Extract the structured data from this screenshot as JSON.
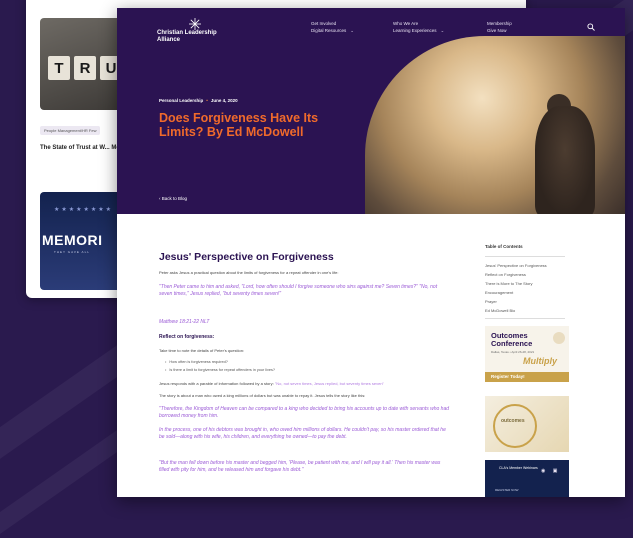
{
  "colors": {
    "background": "#2a1a4e",
    "hero_bg": "#2b1352",
    "title_accent": "#f06a2b",
    "quote_text": "#9b5bd6",
    "heading": "#2b1352",
    "gold": "#c9a24a"
  },
  "back_card": {
    "thumb1_tiles": [
      "T",
      "R",
      "U"
    ],
    "tag": "People Management/HR Few",
    "title": "The State of Trust at W... McKenna",
    "thumb2_text": "MEMORI",
    "thumb2_sub": "THEY GAVE ALL"
  },
  "header": {
    "logo_text": "Christian Leadership Alliance",
    "logo_icon": "star-burst-icon",
    "nav": [
      {
        "line1": "Get Involved",
        "line2": "Digital Resources"
      },
      {
        "line1": "Who We Are",
        "line2": "Learning Experiences"
      },
      {
        "line1": "Membership",
        "line2": "Give Now"
      }
    ],
    "search_icon": "search-icon"
  },
  "hero": {
    "category": "Personal Leadership",
    "date": "June 4, 2020",
    "title": "Does Forgiveness Have Its Limits? By Ed McDowell",
    "back_link": "‹ Back to Blog"
  },
  "article": {
    "heading": "Jesus' Perspective on Forgiveness",
    "intro": "Peter asks Jesus a practical question about the limits of forgiveness for a repeat offender in one's life:",
    "quote1": "\"Then Peter came to him and asked, \"Lord, how often should I forgive someone who sins against me? Seven times?\" \"No, not seven times,\" Jesus replied, \"but seventy times seven!\"",
    "quote1_ref": "Matthew 18:21-22 NLT",
    "subheading": "Reflect on forgiveness:",
    "sub_intro": "Take time to note the details of Peter's question:",
    "bullets": [
      "How often is forgiveness required?",
      "Is there a limit to forgiveness for repeat offenders in your lives?"
    ],
    "response_text": "Jesus responds with a parable of information followed by a story:",
    "response_link": "\"No, not seven times, Jesus replied, but seventy times seven\"",
    "story_intro": "The story is about a man who owed a king millions of dollars but was unable to repay it. Jesus tells the story like this:",
    "quote2a": "\"Therefore, the Kingdom of Heaven can be compared to a king who decided to bring his accounts up to date with servants who had borrowed money from him.",
    "quote2b": "In the process, one of his debtors was brought in, who owed him millions of dollars. He couldn't pay, so his master ordered that he be sold—along with his wife, his children, and everything he owned—to pay the debt.",
    "quote2c": "\"But the man fell down before his master and begged him, 'Please, be patient with me, and I will pay it all.' Then his master was filled with pity for him, and he released him and forgave his debt.\""
  },
  "sidebar": {
    "toc_title": "Table of Contents",
    "toc_items": [
      "Jesus' Perspective on Forgiveness",
      "Reflect on Forgiveness",
      "There is More to The Story",
      "Encouragement",
      "Prayer",
      "Ed McDowell Bio"
    ],
    "ad1": {
      "title_line1": "Outcomes",
      "title_line2": "Conference",
      "sub": "Dallas, Texas • April 26-28, 2021",
      "script": "Multiply",
      "button": "Register Today!"
    },
    "ad2": {
      "text": "outcomes"
    },
    "ad3": {
      "text": "CLA's Member Webinars",
      "foot": "REGISTER NOW"
    }
  }
}
